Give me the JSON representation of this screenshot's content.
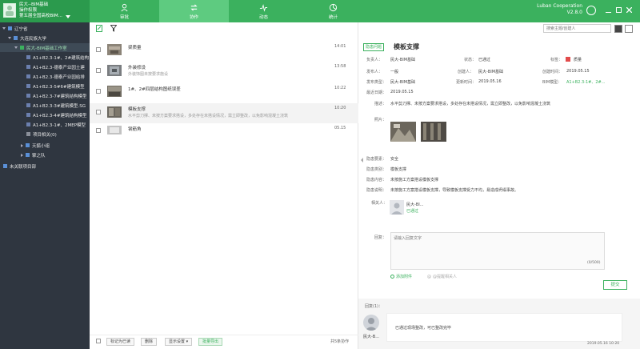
{
  "user": {
    "line1": "民大--BIM基础",
    "line2": "操作权限",
    "line3": "第五届全国高校BIM..."
  },
  "nav": [
    {
      "label": "审批"
    },
    {
      "label": "协作"
    },
    {
      "label": "动态"
    },
    {
      "label": "统计"
    }
  ],
  "brand": {
    "name": "Luban Cooperation",
    "version": "V2.8.0"
  },
  "tree": [
    {
      "label": "辽宁省",
      "level": 0,
      "kind": "caret-open"
    },
    {
      "label": "大连民族大学",
      "level": 1,
      "kind": "caret-open"
    },
    {
      "label": "民大-BIM基础工作室",
      "level": 2,
      "kind": "caret-open-green"
    },
    {
      "label": "A1+B2.3-1#、2#建筑结构",
      "level": 3,
      "kind": "doc"
    },
    {
      "label": "A1+B2.3-德泰产业园土建",
      "level": 3,
      "kind": "doc"
    },
    {
      "label": "A1+B2.3-德泰产业园给排",
      "level": 3,
      "kind": "doc"
    },
    {
      "label": "A1+B2.3-5#6#建筑模型",
      "level": 3,
      "kind": "doc"
    },
    {
      "label": "A1+B2.3-7#建筑结构模型",
      "level": 3,
      "kind": "doc"
    },
    {
      "label": "A1+B2.3-3#建筑模型.SG",
      "level": 3,
      "kind": "doc"
    },
    {
      "label": "A1+B2.3-4#建筑结构模型",
      "level": 3,
      "kind": "doc"
    },
    {
      "label": "A1+B2.3-1#、2MEP模型",
      "level": 3,
      "kind": "doc"
    },
    {
      "label": "项目相关(0)",
      "level": 3,
      "kind": "gray"
    },
    {
      "label": "天狐小组",
      "level": 2,
      "kind": "caret-closed"
    },
    {
      "label": "擎之队",
      "level": 2,
      "kind": "caret-closed"
    },
    {
      "label": "未关联项目部",
      "level": 0,
      "kind": "plain"
    }
  ],
  "list": [
    {
      "title": "梁质量",
      "subtitle": "",
      "time": "14:01"
    },
    {
      "title": "外装修设",
      "subtitle": "外装饰图未按要求施设",
      "time": "13:58"
    },
    {
      "title": "1#、2#四层结构图纸误差",
      "subtitle": "",
      "time": "10:22"
    },
    {
      "title": "模板支撑",
      "subtitle": "水平剪刀撑、未按方案要求搭设，多处存在未搭设情况，需立即整改，以免影响混凝土浇筑",
      "time": "10:20"
    },
    {
      "title": "钢筋角",
      "subtitle": "",
      "time": "05.15"
    }
  ],
  "list_footer": {
    "mark_read": "标记为已读",
    "delete": "删除",
    "display": "显示设置",
    "export": "批量导出",
    "total": "共5条协作"
  },
  "search": {
    "placeholder": "搜索主题/创建人"
  },
  "detail": {
    "tag": "隐患问题",
    "title": "模板支撑",
    "fields": {
      "owner_label": "负责人：",
      "owner": "民大-BIM基础",
      "status_label": "状态：",
      "status": "已通过",
      "tag_label": "标签：",
      "tag_value": "质量",
      "send_label": "发布人：",
      "send": "一般",
      "creator_label": "创建人：",
      "creator": "民大-BIM基础",
      "created_label": "创建时间：",
      "created": "2019.05.15",
      "type_label": "发布类型：",
      "type": "民大-BIM基础",
      "update_label": "更新时间：",
      "update": "2019.05.16",
      "model_label": "BIM模型：",
      "model": "A1+B2.3-1#、2#...",
      "deadline_label": "最近日期：",
      "deadline": "2019.05.15",
      "desc_label": "描述：",
      "desc": "水平剪刀撑、未按方案要求搭设，多处存在未搭设情况，需立即整改，以免影响混凝土浇筑",
      "photo_label": "照片：",
      "risk_label": "隐患要素：",
      "risk": "安全",
      "cat_label": "隐患类别：",
      "cat": "模板支撑",
      "content_label": "隐患内容：",
      "content": "未按施工方案搭设模板支撑",
      "note_label": "隐患说明：",
      "note": "未按施工方案搭设模板支撑，导致模板支撑受力不均，易造成坍塌事故。",
      "related_label": "相关人：",
      "related_name": "民大-BI...",
      "related_status": "已通过"
    },
    "reply_label": "回复：",
    "reply_placeholder": "请输入回复文字",
    "reply_count": "(0/500)",
    "attach": "添加附件",
    "mention": "@提醒相关人",
    "submit": "提交",
    "records_label": "回复(1)：",
    "record_name": "民大-B...",
    "record_text": "已通过现场整改，可已整改完毕",
    "record_time": "2019.05.16 10:20"
  },
  "colors": {
    "accent": "#3bb15e",
    "sidebar": "#2f3640",
    "tag_red": "#e24b4b"
  }
}
